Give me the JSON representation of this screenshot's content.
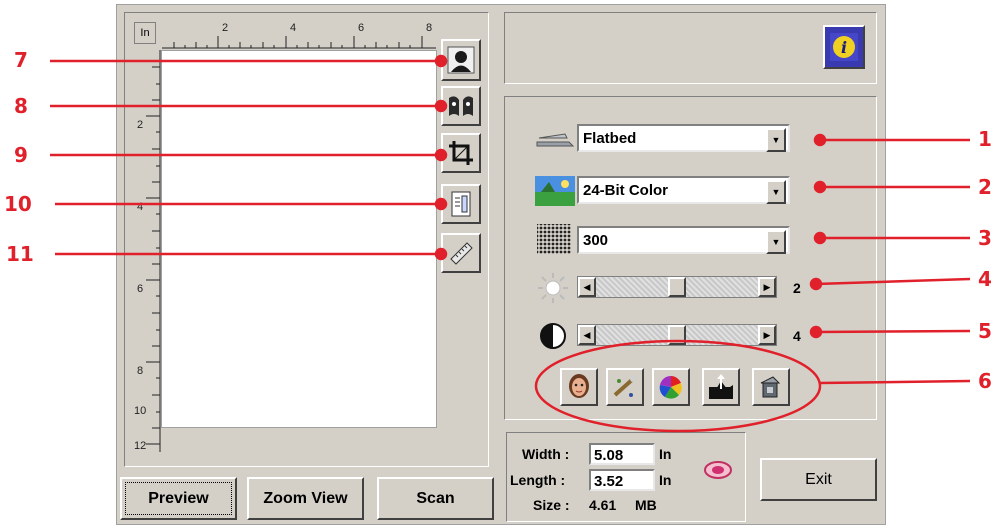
{
  "ruler": {
    "unit": "In",
    "top_labels": [
      "2",
      "4",
      "6",
      "8"
    ],
    "left_labels": [
      "2",
      "4",
      "6",
      "8",
      "10",
      "12"
    ]
  },
  "preview_tools": [
    {
      "icon": "auto-scan-icon"
    },
    {
      "icon": "ocr-icon"
    },
    {
      "icon": "crop-icon"
    },
    {
      "icon": "page-scan-icon"
    },
    {
      "icon": "ruler-icon"
    }
  ],
  "bottom_buttons": {
    "preview": "Preview",
    "zoom": "Zoom View",
    "scan": "Scan"
  },
  "settings": {
    "source": "Flatbed",
    "mode": "24-Bit Color",
    "resolution": "300",
    "brightness_value": "2",
    "brightness_level": 0.5,
    "contrast_value": "4",
    "contrast_level": 0.5
  },
  "image_tools": [
    {
      "icon": "descreen-icon"
    },
    {
      "icon": "sharpen-icon"
    },
    {
      "icon": "color-balance-icon"
    },
    {
      "icon": "curve-icon"
    },
    {
      "icon": "filter-icon"
    }
  ],
  "size_info": {
    "width_label": "Width :",
    "width_value": "5.08",
    "width_unit": "In",
    "length_label": "Length :",
    "length_value": "3.52",
    "length_unit": "In",
    "size_label": "Size :",
    "size_value": "4.61",
    "size_unit": "MB"
  },
  "exit_label": "Exit",
  "callouts": {
    "left": [
      "7",
      "8",
      "9",
      "10",
      "11"
    ],
    "right": [
      "1",
      "2",
      "3",
      "4",
      "5",
      "6"
    ],
    "color": "#e0202a"
  }
}
